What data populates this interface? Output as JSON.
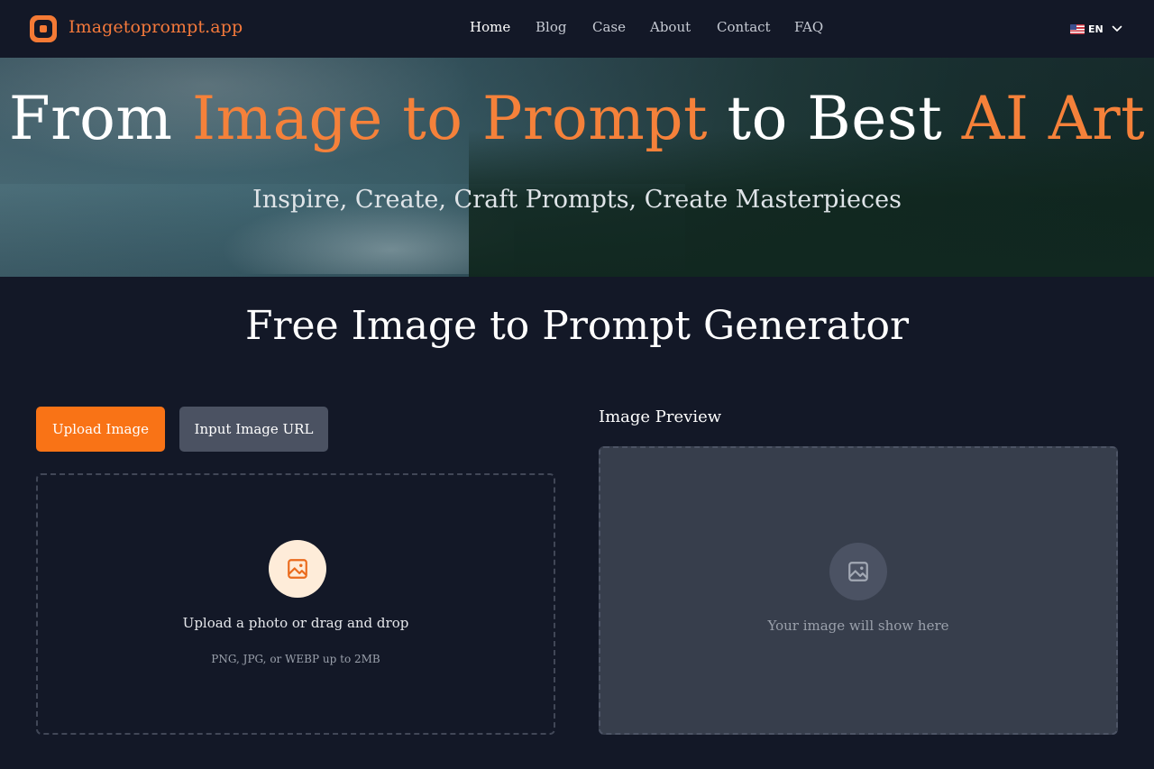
{
  "header": {
    "brand": "Imagetoprompt.app",
    "nav": [
      {
        "label": "Home",
        "active": true
      },
      {
        "label": "Blog",
        "active": false
      },
      {
        "label": "Case",
        "active": false
      },
      {
        "label": "About",
        "active": false
      },
      {
        "label": "Contact",
        "active": false
      },
      {
        "label": "FAQ",
        "active": false
      }
    ],
    "language": {
      "flag_icon": "us-flag-icon",
      "label": "EN"
    }
  },
  "hero": {
    "title_part1": "From ",
    "title_highlight1": "Image to Prompt",
    "title_part2": " to Best ",
    "title_highlight2": "AI Art",
    "subtitle": "Inspire, Create, Craft Prompts, Create Masterpieces"
  },
  "main": {
    "title": "Free Image to Prompt Generator",
    "tabs": {
      "upload_label": "Upload Image",
      "url_label": "Input Image URL"
    },
    "dropzone": {
      "icon": "image-icon",
      "text": "Upload a photo or drag and drop",
      "hint": "PNG, JPG, or WEBP up to 2MB"
    },
    "preview": {
      "label": "Image Preview",
      "icon": "image-icon",
      "placeholder": "Your image will show here"
    }
  },
  "colors": {
    "accent": "#f97316",
    "background": "#131827",
    "secondary_button": "#4b5262",
    "preview_bg": "#373e4c"
  }
}
